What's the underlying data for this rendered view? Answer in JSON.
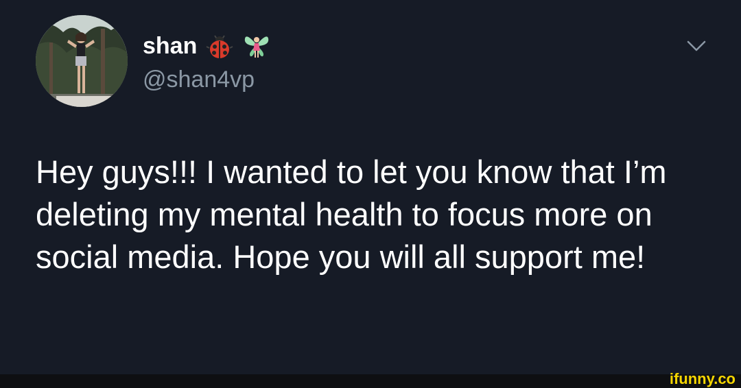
{
  "user": {
    "display_name": "shan",
    "handle": "@shan4vp",
    "emojis": [
      "ladybug-icon",
      "fairy-icon"
    ]
  },
  "tweet": {
    "text": "Hey guys!!! I wanted to let you know that I’m deleting my mental health to focus more on social media. Hope you will all support me!"
  },
  "menu": {
    "icon": "chevron-down-icon"
  },
  "watermark": {
    "text": "ifunny.co"
  },
  "colors": {
    "background": "#161b26",
    "text_primary": "#ffffff",
    "text_secondary": "#8b98a5",
    "watermark": "#f6d600"
  }
}
